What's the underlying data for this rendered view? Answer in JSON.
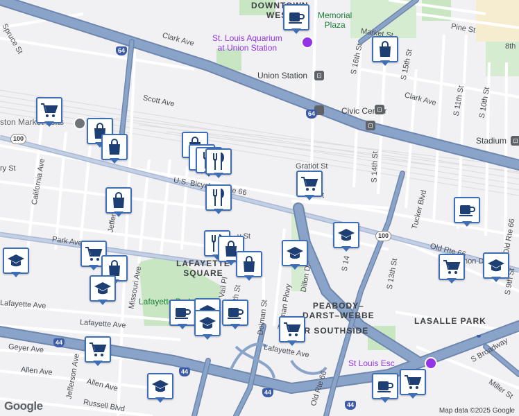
{
  "map": {
    "attribution": "Map data ©2025 Google",
    "logo": "Google",
    "neighborhoods": [
      {
        "id": "downtown-west",
        "text": "DOWNTOWN\nWEST"
      },
      {
        "id": "lafayette-square",
        "text": "LAFAYETTE\nSQUARE"
      },
      {
        "id": "peabody-darst-webbe",
        "text": "PEABODY–\nDARST–WEBBE"
      },
      {
        "id": "near-southside",
        "text": "NEAR SOUTHSIDE"
      },
      {
        "id": "lasalle-park",
        "text": "LASALLE PARK"
      }
    ],
    "pois": [
      {
        "id": "memorial-plaza",
        "text": "Memorial\nPlaza",
        "kind": "park"
      },
      {
        "id": "aquarium",
        "text": "St. Louis Aquarium\nat Union Station",
        "kind": "poi"
      },
      {
        "id": "union-station",
        "text": "Union Station",
        "kind": "station"
      },
      {
        "id": "civic-center",
        "text": "Civic Center",
        "kind": "station"
      },
      {
        "id": "stadium",
        "text": "Stadium",
        "kind": "station"
      },
      {
        "id": "lafayette-park",
        "text": "Lafayette Park",
        "kind": "park"
      },
      {
        "id": "soulard-market",
        "text": "ston Market Lofts",
        "kind": "poi-gray"
      },
      {
        "id": "st-louis-esc",
        "text": "St Louis Esc",
        "kind": "poi"
      }
    ],
    "roads": [
      {
        "id": "spruce-st",
        "text": "Spruce St"
      },
      {
        "id": "clark-ave-1",
        "text": "Clark Ave"
      },
      {
        "id": "clark-ave-2",
        "text": "Clark Ave"
      },
      {
        "id": "market-st",
        "text": "Market St"
      },
      {
        "id": "pine-st",
        "text": "Pine St"
      },
      {
        "id": "8th-st",
        "text": "8th"
      },
      {
        "id": "s-16th-st",
        "text": "S 16th St"
      },
      {
        "id": "s-15th-st",
        "text": "S 15th St"
      },
      {
        "id": "scott-ave",
        "text": "Scott Ave"
      },
      {
        "id": "s-11th-st",
        "text": "S 11th St"
      },
      {
        "id": "s-10th-st",
        "text": "S 10th St"
      },
      {
        "id": "s-14th-st-1",
        "text": "S 14th St"
      },
      {
        "id": "tucker-blvd",
        "text": "Tucker Blvd"
      },
      {
        "id": "gratiot-st",
        "text": "Gratiot St"
      },
      {
        "id": "chouteau",
        "text": "t"
      },
      {
        "id": "california-ave",
        "text": "California Ave"
      },
      {
        "id": "jefferson-ave-1",
        "text": "Jefferson Ave"
      },
      {
        "id": "us-bicycle",
        "text": "U.S. Bicycle Route 66"
      },
      {
        "id": "park-ave",
        "text": "Park Ave"
      },
      {
        "id": "ry-st",
        "text": "ry St"
      },
      {
        "id": "missouri-ave",
        "text": "Missouri Ave"
      },
      {
        "id": "dolman-st",
        "text": "Dolman St"
      },
      {
        "id": "truman-pkwy",
        "text": "Truman Pkwy"
      },
      {
        "id": "dillon-dr",
        "text": "Dillon Dr"
      },
      {
        "id": "s-14th-st-2",
        "text": "S 14"
      },
      {
        "id": "s-13th-st",
        "text": "S 13th St"
      },
      {
        "id": "old-rte-66-1",
        "text": "Old Rte 66"
      },
      {
        "id": "old-rte-66-2",
        "text": "Old Rte 66"
      },
      {
        "id": "old-rte-66-3",
        "text": "Old Rte 66"
      },
      {
        "id": "old-rte-66-4",
        "text": "Old Rte 66"
      },
      {
        "id": "s-9th-st",
        "text": "S 9th St"
      },
      {
        "id": "hon-dr",
        "text": "hon Dr"
      },
      {
        "id": "lafayette-ave-1",
        "text": "Lafayette Ave"
      },
      {
        "id": "lafayette-ave-2",
        "text": "Lafayette Ave"
      },
      {
        "id": "lafayette-ave-3",
        "text": "Lafayette Ave"
      },
      {
        "id": "geyer-ave",
        "text": "Geyer Ave"
      },
      {
        "id": "allen-ave-1",
        "text": "Allen Ave"
      },
      {
        "id": "allen-ave-2",
        "text": "Allen Ave"
      },
      {
        "id": "jefferson-ave-2",
        "text": "Jefferson Ave"
      },
      {
        "id": "russell-blvd",
        "text": "Russell Blvd"
      },
      {
        "id": "miller-st",
        "text": "Miller St"
      },
      {
        "id": "s-broadway",
        "text": "S Broadway"
      },
      {
        "id": "vail-pl",
        "text": "Vail Pl"
      },
      {
        "id": "th-st",
        "text": "th St"
      },
      {
        "id": "y-st",
        "text": "y St"
      }
    ],
    "shields": [
      {
        "id": "i64-a",
        "text": "64",
        "kind": "interstate"
      },
      {
        "id": "i64-b",
        "text": "64",
        "kind": "interstate"
      },
      {
        "id": "i44-a",
        "text": "44",
        "kind": "interstate"
      },
      {
        "id": "i44-b",
        "text": "44",
        "kind": "interstate"
      },
      {
        "id": "i44-c",
        "text": "44",
        "kind": "interstate"
      },
      {
        "id": "i44-d",
        "text": "44",
        "kind": "interstate"
      },
      {
        "id": "mo100-a",
        "text": "100",
        "kind": "state"
      },
      {
        "id": "mo100-b",
        "text": "100",
        "kind": "state"
      }
    ],
    "markers": [
      {
        "icon": "coffee"
      },
      {
        "icon": "bag"
      },
      {
        "icon": "cart"
      },
      {
        "icon": "bag"
      },
      {
        "icon": "bag"
      },
      {
        "icon": "bag"
      },
      {
        "icon": "fork-knife"
      },
      {
        "icon": "fork-knife"
      },
      {
        "icon": "fork-knife"
      },
      {
        "icon": "fork-knife"
      },
      {
        "icon": "cart"
      },
      {
        "icon": "bag"
      },
      {
        "icon": "coffee"
      },
      {
        "icon": "school"
      },
      {
        "icon": "school"
      },
      {
        "icon": "cart"
      },
      {
        "icon": "bag"
      },
      {
        "icon": "school"
      },
      {
        "icon": "fork-knife"
      },
      {
        "icon": "bag"
      },
      {
        "icon": "bag"
      },
      {
        "icon": "school"
      },
      {
        "icon": "cart"
      },
      {
        "icon": "school"
      },
      {
        "icon": "coffee"
      },
      {
        "icon": "school"
      },
      {
        "icon": "coffee"
      },
      {
        "icon": "school"
      },
      {
        "icon": "cart"
      },
      {
        "icon": "cart"
      },
      {
        "icon": "school"
      },
      {
        "icon": "coffee"
      },
      {
        "icon": "cart"
      }
    ]
  },
  "colors": {
    "background": "#f1f0f3",
    "highway": "#8aa3c8",
    "highway_edge": "#6f87ad",
    "street": "#ffffff",
    "park": "#c8e6c1",
    "marker_border": "#3e6fb6",
    "poi_text": "#9334e6",
    "park_text": "#188038"
  }
}
